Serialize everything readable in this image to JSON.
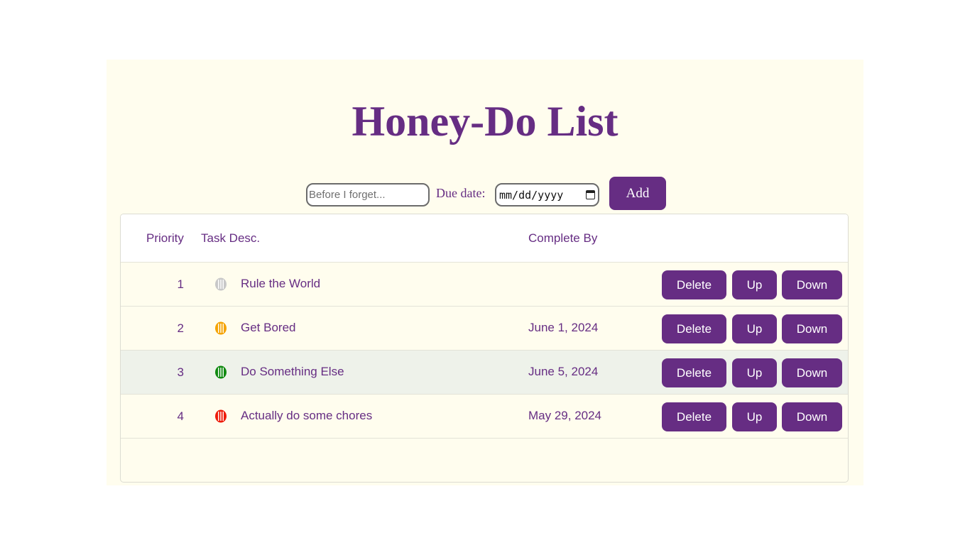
{
  "title": "Honey-Do List",
  "form": {
    "task_placeholder": "Before I forget...",
    "due_label": "Due date:",
    "date_placeholder": "mm/dd/yyyy",
    "add_label": "Add"
  },
  "table": {
    "headers": {
      "priority": "Priority",
      "description": "Task Desc.",
      "complete_by": "Complete By"
    },
    "rows": [
      {
        "priority": "1",
        "status_color": "#c8c8c8",
        "description": "Rule the World",
        "complete_by": "",
        "delete": "Delete",
        "up": "Up",
        "down": "Down"
      },
      {
        "priority": "2",
        "status_color": "#f5a300",
        "description": "Get Bored",
        "complete_by": "June 1, 2024",
        "delete": "Delete",
        "up": "Up",
        "down": "Down"
      },
      {
        "priority": "3",
        "status_color": "#108a10",
        "description": "Do Something Else",
        "complete_by": "June 5, 2024",
        "delete": "Delete",
        "up": "Up",
        "down": "Down"
      },
      {
        "priority": "4",
        "status_color": "#ee1c0a",
        "description": "Actually do some chores",
        "complete_by": "May 29, 2024",
        "delete": "Delete",
        "up": "Up",
        "down": "Down"
      }
    ]
  },
  "colors": {
    "accent": "#662d83",
    "background": "#fffdee",
    "highlight_row": "#eef2ea"
  },
  "icons": {
    "status": "striped-circle-icon",
    "calendar": "calendar-icon"
  }
}
